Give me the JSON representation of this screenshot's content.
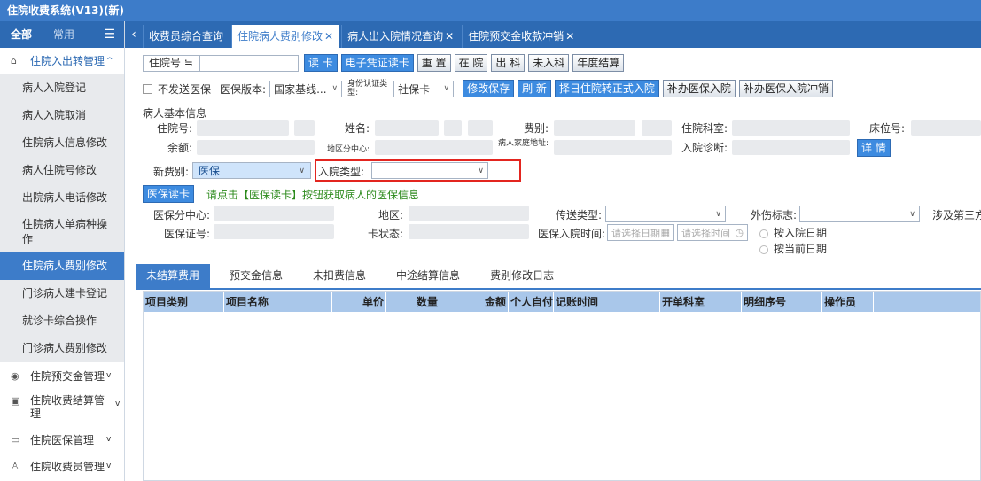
{
  "app": {
    "title": "住院收费系统(V13)(新)"
  },
  "sidebar": {
    "tabs": [
      "全部",
      "常用"
    ],
    "groups": [
      {
        "label": "住院入出转管理",
        "icon": "ward-icon",
        "open": true
      },
      {
        "label": "住院预交金管理",
        "icon": "coin-icon"
      },
      {
        "label": "住院收费结算管理",
        "icon": "invoice-icon"
      },
      {
        "label": "住院医保管理",
        "icon": "card-icon"
      },
      {
        "label": "住院收费员管理",
        "icon": "user-icon"
      }
    ],
    "items": [
      "病人入院登记",
      "病人入院取消",
      "住院病人信息修改",
      "病人住院号修改",
      "出院病人电话修改",
      "住院病人单病种操作",
      "住院病人费别修改",
      "门诊病人建卡登记",
      "就诊卡综合操作",
      "门诊病人费别修改"
    ],
    "active_item": "住院病人费别修改"
  },
  "tabs": [
    {
      "label": "收费员综合查询",
      "closable": false
    },
    {
      "label": "住院病人费别修改",
      "closable": true,
      "active": true
    },
    {
      "label": "病人出入院情况查询",
      "closable": true
    },
    {
      "label": "住院预交金收款冲销",
      "closable": true
    }
  ],
  "toolbar1": {
    "search_label": "住院号 ≒",
    "search_value": "",
    "buttons": [
      "读 卡",
      "电子凭证读卡",
      "重 置",
      "在 院",
      "出 科",
      "未入科",
      "年度结算"
    ]
  },
  "toolbar2": {
    "no_send_label": "不发送医保",
    "version_label": "医保版本:",
    "version_value": "国家基线...",
    "idtype_label": "身份认证类型:",
    "idtype_value": "社保卡",
    "buttons": [
      "修改保存",
      "刷 新",
      "择日住院转正式入院",
      "补办医保入院",
      "补办医保入院冲销"
    ]
  },
  "basic_info": {
    "title": "病人基本信息",
    "fields": {
      "inpatient_no": "住院号:",
      "name": "姓名:",
      "fee_type": "费别:",
      "dept": "住院科室:",
      "bed": "床位号:",
      "balance": "余额:",
      "region_center": "地区分中心:",
      "address": "病人家庭地址:",
      "diagnosis": "入院诊断:"
    },
    "detail_button": "详 情"
  },
  "new_fee": {
    "label": "新费别:",
    "value": "医保"
  },
  "admit_type": {
    "label": "入院类型:",
    "value": ""
  },
  "insurance": {
    "read_button": "医保读卡",
    "hint": "请点击【医保读卡】按钮获取病人的医保信息",
    "center_label": "医保分中心:",
    "region_label": "地区:",
    "transfer_label": "传送类型:",
    "injury_label": "外伤标志:",
    "third_label": "涉及第三方",
    "card_no_label": "医保证号:",
    "card_status_label": "卡状态:",
    "admit_time_label": "医保入院时间:",
    "date_placeholder": "请选择日期",
    "time_placeholder": "请选择时间",
    "radio1": "按入院日期",
    "radio2": "按当前日期"
  },
  "subtabs": [
    "未结算费用",
    "预交金信息",
    "未扣费信息",
    "中途结算信息",
    "费别修改日志"
  ],
  "grid": {
    "columns": [
      "项目类别",
      "项目名称",
      "单价",
      "数量",
      "金额",
      "个人自付",
      "记账时间",
      "开单科室",
      "明细序号",
      "操作员"
    ]
  }
}
